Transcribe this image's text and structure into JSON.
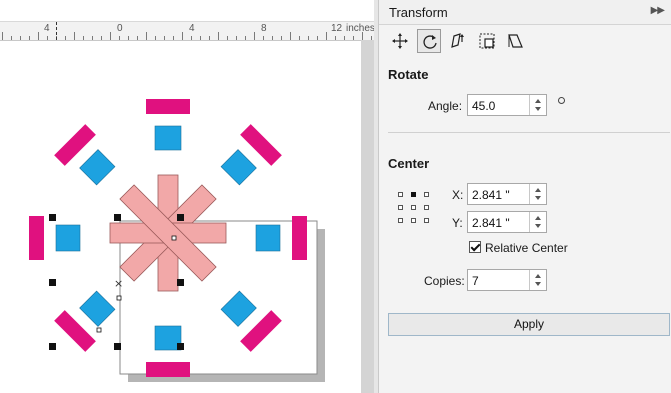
{
  "ruler": {
    "unit": "inches",
    "labels": [
      "4",
      "0",
      "4",
      "8",
      "12"
    ]
  },
  "panel": {
    "title": "Transform",
    "collapse_arrows": "▶▶",
    "tools": [
      "position-icon",
      "rotate-icon",
      "scale-mirror-icon",
      "size-icon",
      "skew-icon"
    ]
  },
  "rotate": {
    "section_label": "Rotate",
    "angle_label": "Angle:",
    "angle_value": "45.0"
  },
  "center": {
    "section_label": "Center",
    "x_label": "X:",
    "x_value": "2.841 \"",
    "y_label": "Y:",
    "y_value": "2.841 \"",
    "relative_center_label": "Relative Center",
    "relative_center_checked": true,
    "copies_label": "Copies:",
    "copies_value": "7"
  },
  "apply_label": "Apply",
  "colors": {
    "magenta": "#e0117f",
    "blue": "#1da2e0",
    "pink": "#f2a8a8",
    "panel_bg": "#f3f3f3"
  }
}
